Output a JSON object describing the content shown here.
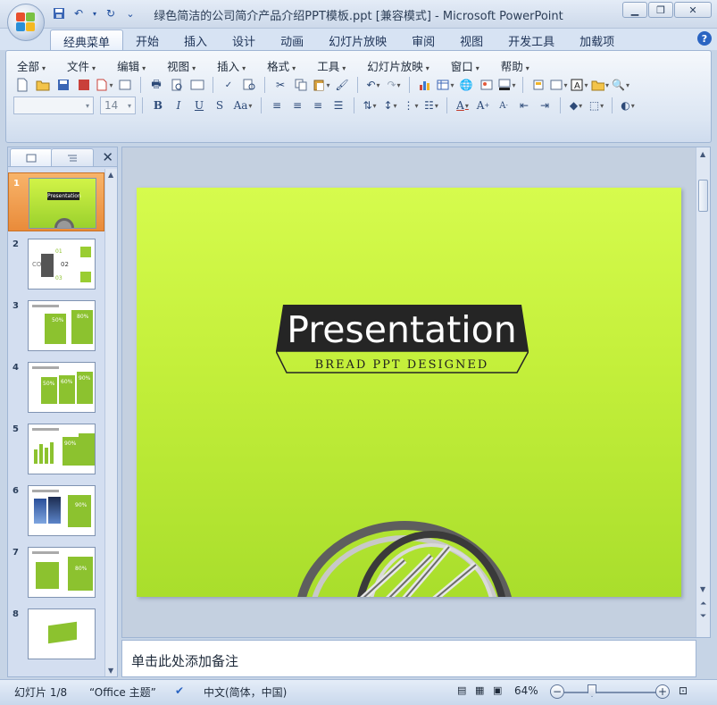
{
  "window": {
    "title": "绿色简洁的公司简介产品介绍PPT模板.ppt [兼容模式] - Microsoft PowerPoint"
  },
  "quick_access": [
    "save-icon",
    "undo-icon",
    "redo-icon",
    "customize-icon"
  ],
  "ribbon_tabs": [
    "经典菜单",
    "开始",
    "插入",
    "设计",
    "动画",
    "幻灯片放映",
    "审阅",
    "视图",
    "开发工具",
    "加载项"
  ],
  "classic_menus": [
    "全部",
    "文件",
    "编辑",
    "视图",
    "插入",
    "格式",
    "工具",
    "幻灯片放映",
    "窗口",
    "帮助"
  ],
  "font": {
    "name": "",
    "size": "14"
  },
  "slide": {
    "title": "Presentation",
    "subtitle": "BREAD  PPT  DESIGNED",
    "background_color": "#c3ef3a"
  },
  "thumbnails": [
    {
      "number": "1",
      "selected": true
    },
    {
      "number": "2",
      "selected": false
    },
    {
      "number": "3",
      "selected": false
    },
    {
      "number": "4",
      "selected": false
    },
    {
      "number": "5",
      "selected": false
    },
    {
      "number": "6",
      "selected": false
    },
    {
      "number": "7",
      "selected": false
    },
    {
      "number": "8",
      "selected": false
    }
  ],
  "thumb_text": {
    "t1_title": "Presentation",
    "t2_label_a": "01",
    "t2_label_b": "02",
    "t2_label_c": "03",
    "t3_pct_a": "50%",
    "t3_pct_b": "80%",
    "t4_pct_a": "50%",
    "t4_pct_b": "60%",
    "t4_pct_c": "90%",
    "t5_pct": "90%",
    "t6_pct": "90%",
    "t7_pct": "80%"
  },
  "notes": {
    "placeholder": "单击此处添加备注"
  },
  "status": {
    "slide_indicator": "幻灯片 1/8",
    "theme": "“Office 主题”",
    "language": "中文(简体，中国)",
    "zoom": "64%"
  }
}
